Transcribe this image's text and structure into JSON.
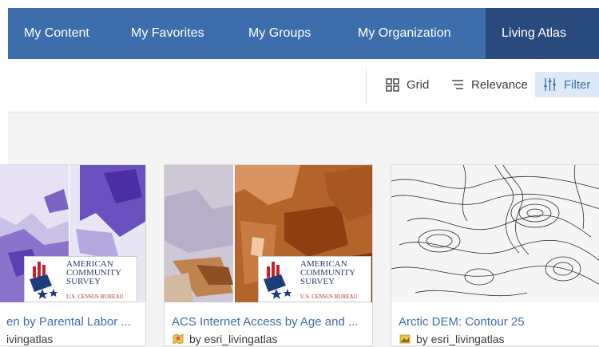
{
  "nav": {
    "tabs": [
      {
        "label": "My Content"
      },
      {
        "label": "My Favorites"
      },
      {
        "label": "My Groups"
      },
      {
        "label": "My Organization"
      },
      {
        "label": "Living Atlas",
        "active": true
      }
    ]
  },
  "toolbar": {
    "grid_label": "Grid",
    "relevance_label": "Relevance",
    "filter_label": "Filter"
  },
  "cards": [
    {
      "title": "en by Parental Labor ...",
      "owner": "ivingatlas",
      "icon": "map-layer-icon",
      "badge": {
        "line1": "AMERICAN",
        "line2": "COMMUNITY",
        "line3": "SURVEY",
        "sub": "U.S. CENSUS BUREAU"
      }
    },
    {
      "title": "ACS Internet Access by Age and ...",
      "owner": "by esri_livingatlas",
      "icon": "map-layer-icon",
      "badge": {
        "line1": "AMERICAN",
        "line2": "COMMUNITY",
        "line3": "SURVEY",
        "sub": "U.S. CENSUS BUREAU"
      }
    },
    {
      "title": "Arctic DEM: Contour 25",
      "owner": "by esri_livingatlas",
      "icon": "imagery-layer-icon"
    }
  ],
  "colors": {
    "nav_bg": "#3d6dab",
    "nav_active": "#294a7c",
    "link": "#3d6dab",
    "filter_bg": "#dfeaf8"
  }
}
